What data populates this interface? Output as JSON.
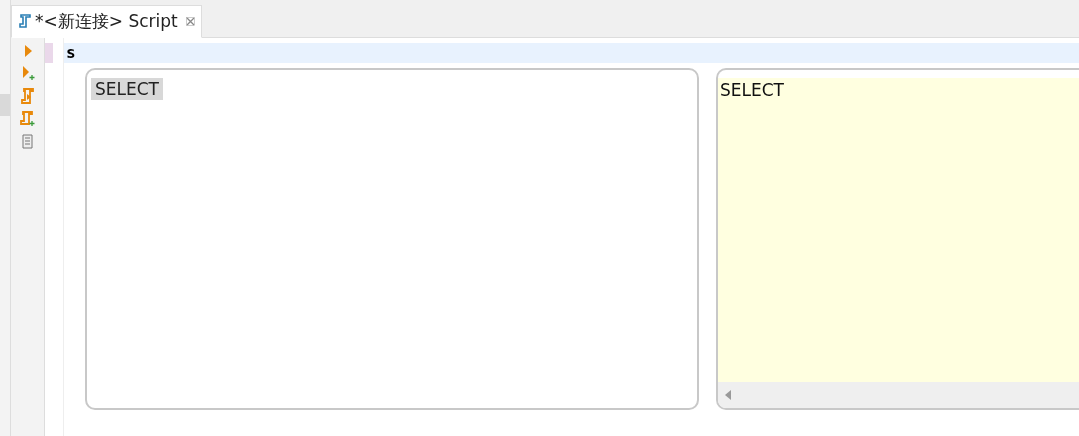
{
  "tab": {
    "title": "*<新连接> Script",
    "selected": true
  },
  "editor": {
    "lines": [
      "s"
    ]
  },
  "completion": {
    "items": [
      {
        "label": "SELECT",
        "selected": true
      }
    ]
  },
  "doc_popup": {
    "text": "SELECT"
  }
}
